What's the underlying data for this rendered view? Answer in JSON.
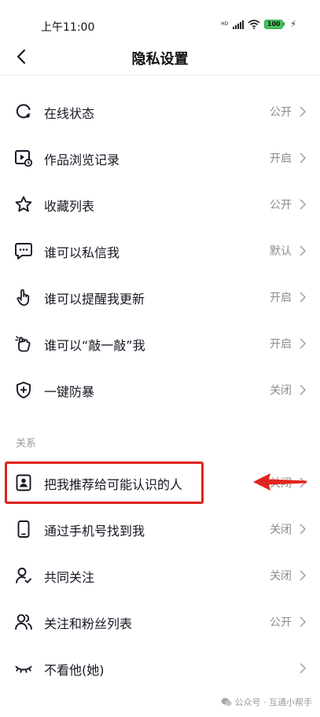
{
  "status_bar": {
    "time": "上午11:00",
    "network": "HD",
    "battery": "100"
  },
  "nav": {
    "title": "隐私设置"
  },
  "settings": [
    {
      "label": "在线状态",
      "value": "公开",
      "icon": "online-status-icon"
    },
    {
      "label": "作品浏览记录",
      "value": "开启",
      "icon": "view-history-icon"
    },
    {
      "label": "收藏列表",
      "value": "公开",
      "icon": "star-icon"
    },
    {
      "label": "谁可以私信我",
      "value": "默认",
      "icon": "message-icon"
    },
    {
      "label": "谁可以提醒我更新",
      "value": "开启",
      "icon": "poke-finger-icon"
    },
    {
      "label": "谁可以“敲一敲”我",
      "value": "开启",
      "icon": "knock-hand-icon"
    },
    {
      "label": "一键防暴",
      "value": "关闭",
      "icon": "shield-plus-icon"
    }
  ],
  "relations": {
    "section_title": "关系",
    "items": [
      {
        "label": "把我推荐给可能认识的人",
        "value": "关闭",
        "icon": "contact-card-icon"
      },
      {
        "label": "通过手机号找到我",
        "value": "关闭",
        "icon": "phone-icon"
      },
      {
        "label": "共同关注",
        "value": "关闭",
        "icon": "person-check-icon"
      },
      {
        "label": "关注和粉丝列表",
        "value": "公开",
        "icon": "users-icon"
      },
      {
        "label": "不看他(她)",
        "value": "",
        "icon": "closed-eye-icon"
      }
    ]
  },
  "annotation": {
    "highlight_color": "#e0241e"
  },
  "watermark": {
    "text": "公众号 · 互通小帮手"
  }
}
